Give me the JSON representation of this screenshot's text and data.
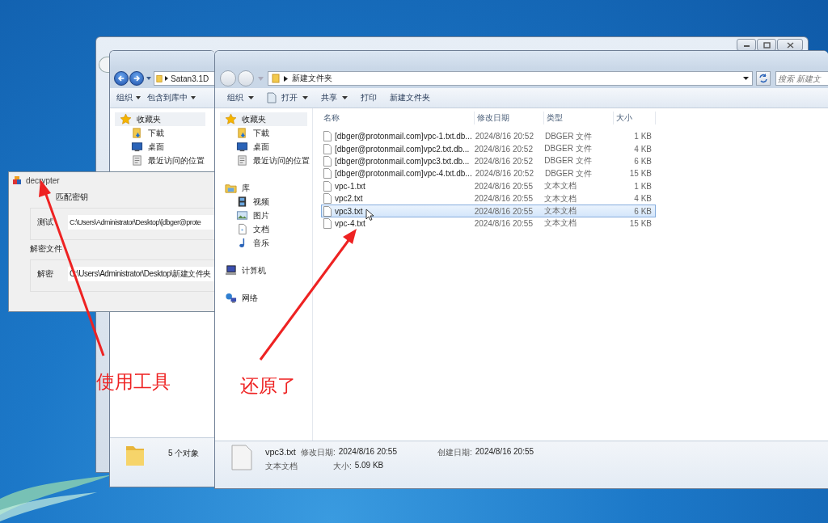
{
  "left_explorer": {
    "address": "Satan3.1D",
    "toolbar": [
      "组织",
      "包含到库中"
    ],
    "nav": [
      {
        "label": "收藏夹",
        "kind": "star",
        "selected": true,
        "children": [
          {
            "label": "下載",
            "kind": "download",
            "selected": false
          },
          {
            "label": "桌面",
            "kind": "desktop",
            "selected": false
          },
          {
            "label": "最近访问的位置",
            "kind": "recent",
            "selected": false
          }
        ]
      }
    ],
    "status": "5 个对象"
  },
  "decrypter": {
    "title": "decrypter",
    "groups": [
      {
        "title": "匹配密钥",
        "label": "测试",
        "value": "C:\\Users\\Administrator\\Desktop\\[dbger@prote"
      },
      {
        "title": "解密文件",
        "label": "解密",
        "value": "C:\\Users\\Administrator\\Desktop\\新建文件夹"
      }
    ]
  },
  "explorer": {
    "address": "新建文件夹",
    "search": {
      "placeholder": "搜索 新建文"
    },
    "toolbar": [
      {
        "label": "组织",
        "dropdown": true,
        "icon": false
      },
      {
        "label": "打开",
        "dropdown": true,
        "icon": true
      },
      {
        "label": "共享",
        "dropdown": true,
        "icon": false
      },
      {
        "label": "打印",
        "dropdown": false,
        "icon": false
      },
      {
        "label": "新建文件夹",
        "dropdown": false,
        "icon": false
      }
    ],
    "nav": [
      {
        "label": "收藏夹",
        "kind": "star",
        "selected": true,
        "children": [
          {
            "label": "下載",
            "kind": "download",
            "selected": false
          },
          {
            "label": "桌面",
            "kind": "desktop",
            "selected": false
          },
          {
            "label": "最近访问的位置",
            "kind": "recent",
            "selected": false
          }
        ]
      },
      {
        "label": "库",
        "kind": "library",
        "selected": false,
        "children": [
          {
            "label": "视频",
            "kind": "video",
            "selected": false
          },
          {
            "label": "图片",
            "kind": "image",
            "selected": false
          },
          {
            "label": "文档",
            "kind": "document",
            "selected": false
          },
          {
            "label": "音乐",
            "kind": "music",
            "selected": false
          }
        ]
      },
      {
        "label": "计算机",
        "kind": "computer",
        "selected": false
      },
      {
        "label": "网络",
        "kind": "network",
        "selected": false
      }
    ],
    "columns": [
      "名称",
      "修改日期",
      "类型",
      "大小"
    ],
    "rows": [
      {
        "name": "[dbger@protonmail.com]vpc-1.txt.db...",
        "date": "2024/8/16 20:52",
        "type": "DBGER 文件",
        "size": "1 KB",
        "selected": false
      },
      {
        "name": "[dbger@protonmail.com]vpc2.txt.db...",
        "date": "2024/8/16 20:52",
        "type": "DBGER 文件",
        "size": "4 KB",
        "selected": false
      },
      {
        "name": "[dbger@protonmail.com]vpc3.txt.db...",
        "date": "2024/8/16 20:52",
        "type": "DBGER 文件",
        "size": "6 KB",
        "selected": false
      },
      {
        "name": "[dbger@protonmail.com]vpc-4.txt.db...",
        "date": "2024/8/16 20:52",
        "type": "DBGER 文件",
        "size": "15 KB",
        "selected": false
      },
      {
        "name": "vpc-1.txt",
        "date": "2024/8/16 20:55",
        "type": "文本文档",
        "size": "1 KB",
        "selected": false
      },
      {
        "name": "vpc2.txt",
        "date": "2024/8/16 20:55",
        "type": "文本文档",
        "size": "4 KB",
        "selected": false
      },
      {
        "name": "vpc3.txt",
        "date": "2024/8/16 20:55",
        "type": "文本文档",
        "size": "6 KB",
        "selected": true
      },
      {
        "name": "vpc-4.txt",
        "date": "2024/8/16 20:55",
        "type": "文本文档",
        "size": "15 KB",
        "selected": false
      }
    ],
    "details": {
      "name": "vpc3.txt",
      "type": "文本文档",
      "modified": {
        "label": "修改日期:",
        "value": "2024/8/16 20:55"
      },
      "size": {
        "label": "大小:",
        "value": "5.09 KB"
      },
      "created": {
        "label": "创建日期:",
        "value": "2024/8/16 20:55"
      }
    }
  },
  "annotations": [
    "使用工具",
    "还原了"
  ]
}
